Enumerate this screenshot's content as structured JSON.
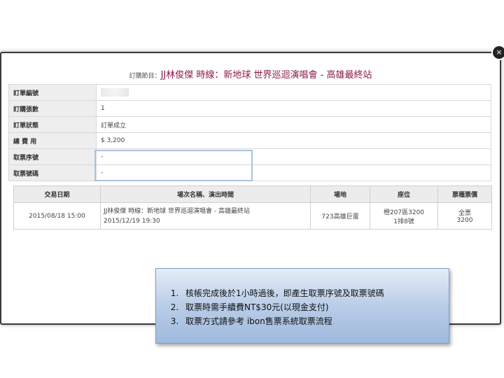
{
  "order": {
    "title_prefix": "訂購節目：",
    "title": "JJ林俊傑 時線：新地球 世界巡迴演唱會 - 高雄最終站"
  },
  "info_rows": [
    {
      "label": "訂單編號",
      "value": ""
    },
    {
      "label": "訂購張數",
      "value": "1"
    },
    {
      "label": "訂單狀態",
      "value": "訂單成立"
    },
    {
      "label": "總 費 用",
      "value": "$ 3,200"
    },
    {
      "label": "取票序號",
      "value": "-"
    },
    {
      "label": "取票號碼",
      "value": "-"
    }
  ],
  "detail": {
    "headers": [
      "交易日期",
      "場次名稱、演出時間",
      "場地",
      "座位",
      "票種票價"
    ],
    "row": {
      "date": "2015/08/18 15:00",
      "event_name": "JJ林俊傑 時線：新地球 世界巡迴演唱會 - 高雄最終站",
      "event_time": "2015/12/19 19:30",
      "venue": "723高雄巨蛋",
      "seat_line1": "橙207區3200",
      "seat_line2": "1排8號",
      "ticket_type": "全票",
      "ticket_price": "3200"
    }
  },
  "notes": [
    "核帳完成後於1小時過後，即產生取票序號及取票號碼",
    "取票時需手續費NT$30元(以現金支付)",
    "取票方式請參考 ibon售票系統取票流程"
  ],
  "close_symbol": "×"
}
